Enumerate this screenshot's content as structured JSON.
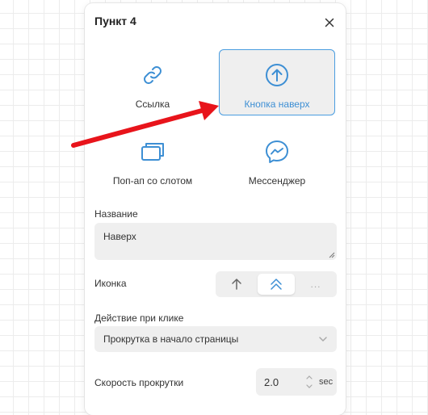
{
  "panel": {
    "title": "Пункт 4"
  },
  "tiles": [
    {
      "label": "Ссылка",
      "icon": "link-icon"
    },
    {
      "label": "Кнопка наверх",
      "icon": "arrow-up-circle-icon",
      "selected": true
    },
    {
      "label": "Поп-ап со слотом",
      "icon": "popup-windows-icon"
    },
    {
      "label": "Мессенджер",
      "icon": "messenger-icon"
    }
  ],
  "name_field": {
    "label": "Название",
    "value": "Наверх"
  },
  "icon_field": {
    "label": "Иконка",
    "options": [
      "arrow-up-icon",
      "double-chevron-up-icon",
      "more"
    ],
    "selected_index": 1,
    "more_label": "..."
  },
  "action_field": {
    "label": "Действие при клике",
    "value": "Прокрутка в начало страницы"
  },
  "speed_field": {
    "label": "Скорость прокрутки",
    "value": "2.0",
    "unit": "sec"
  },
  "colors": {
    "accent": "#3d8fd4",
    "arrow": "#e8141b",
    "field_bg": "#efefef"
  }
}
